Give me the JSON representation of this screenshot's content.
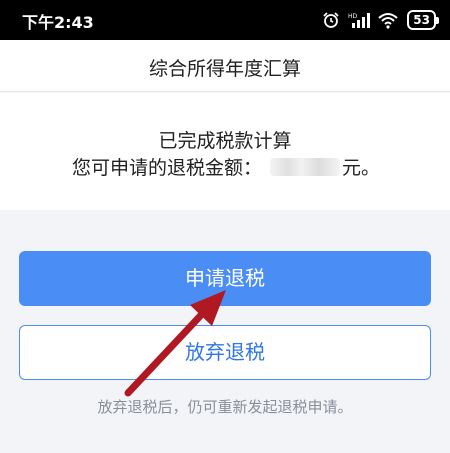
{
  "status_bar": {
    "time": "下午2:43",
    "battery": "53",
    "icons": [
      "alarm-icon",
      "signal-icon",
      "wifi-icon",
      "battery-icon"
    ]
  },
  "header": {
    "title": "综合所得年度汇算"
  },
  "result": {
    "line1": "已完成税款计算",
    "line2_prefix": "您可申请的退税金额：",
    "line2_suffix": "元。"
  },
  "actions": {
    "apply_label": "申请退税",
    "abandon_label": "放弃退税"
  },
  "note": "放弃退税后，仍可重新发起退税申请。",
  "colors": {
    "primary": "#4a8df5",
    "arrow": "#b01822",
    "background": "#f2f4f7"
  }
}
